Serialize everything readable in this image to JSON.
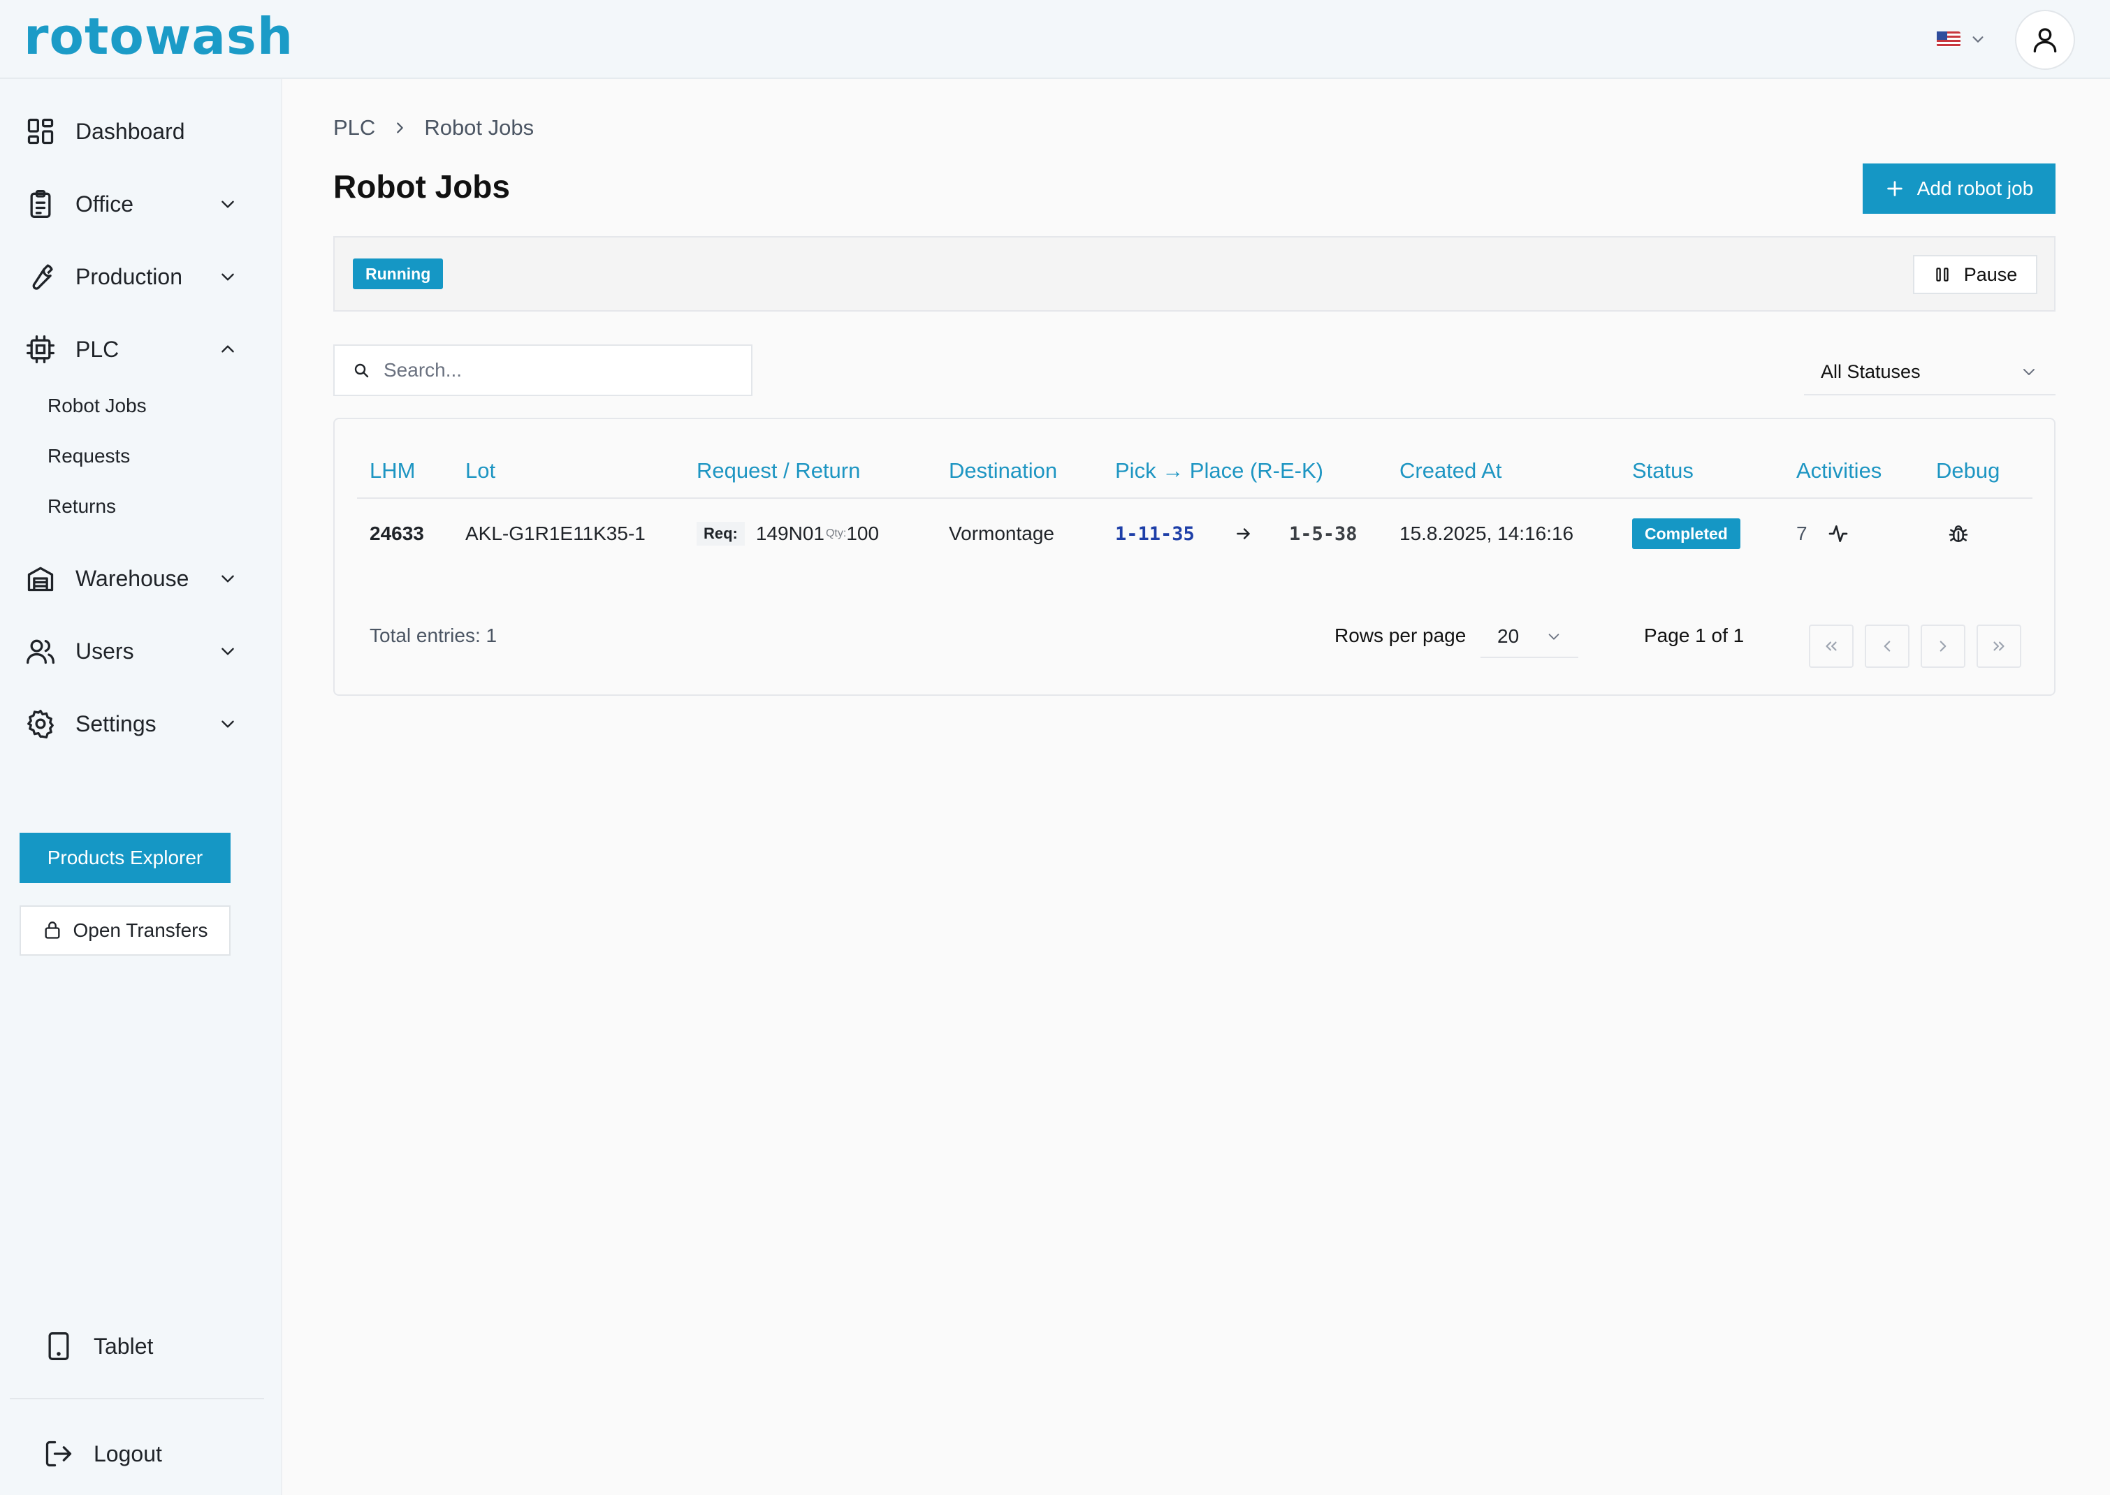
{
  "app": {
    "logo_text": "rotowash",
    "language_flag": "us-flag-icon"
  },
  "sidebar": {
    "items": [
      {
        "label": "Dashboard",
        "icon": "dashboard-icon"
      },
      {
        "label": "Office",
        "icon": "clipboard-icon"
      },
      {
        "label": "Production",
        "icon": "wrench-icon"
      },
      {
        "label": "PLC",
        "icon": "chip-icon",
        "expanded": true
      },
      {
        "label": "Warehouse",
        "icon": "warehouse-icon"
      },
      {
        "label": "Users",
        "icon": "users-icon"
      },
      {
        "label": "Settings",
        "icon": "gear-icon"
      }
    ],
    "plc_subitems": [
      "Robot Jobs",
      "Requests",
      "Returns"
    ],
    "products_explorer": "Products Explorer",
    "open_transfers": "Open Transfers",
    "tablet": "Tablet",
    "logout": "Logout"
  },
  "breadcrumb": {
    "parent": "PLC",
    "current": "Robot Jobs"
  },
  "page": {
    "title": "Robot Jobs",
    "add_button": "Add robot job",
    "status_badge": "Running",
    "pause_button": "Pause"
  },
  "filters": {
    "search_placeholder": "Search...",
    "search_value": "",
    "status_selected": "All Statuses"
  },
  "table": {
    "columns": [
      "LHM",
      "Lot",
      "Request / Return",
      "Destination",
      "Pick → Place (R-E-K)",
      "Created At",
      "Status",
      "Activities",
      "Debug"
    ],
    "rows": [
      {
        "lhm": "24633",
        "lot": "AKL-G1R1E11K35-1",
        "req_label": "Req:",
        "req_value": "149N01",
        "qty_label": "Qty:",
        "qty_value": "100",
        "destination": "Vormontage",
        "pick": "1-11-35",
        "place": "1-5-38",
        "created_at": "15.8.2025, 14:16:16",
        "status": "Completed",
        "activities": "7"
      }
    ]
  },
  "pagination": {
    "total_entries": "Total entries: 1",
    "rows_per_page_label": "Rows per page",
    "rows_per_page_value": "20",
    "page_info": "Page 1 of 1"
  },
  "colors": {
    "accent": "#1597c5",
    "header_text": "#1d95c2",
    "pick_text": "#1e3fa8",
    "sidebar_bg": "#f3f7fa"
  }
}
